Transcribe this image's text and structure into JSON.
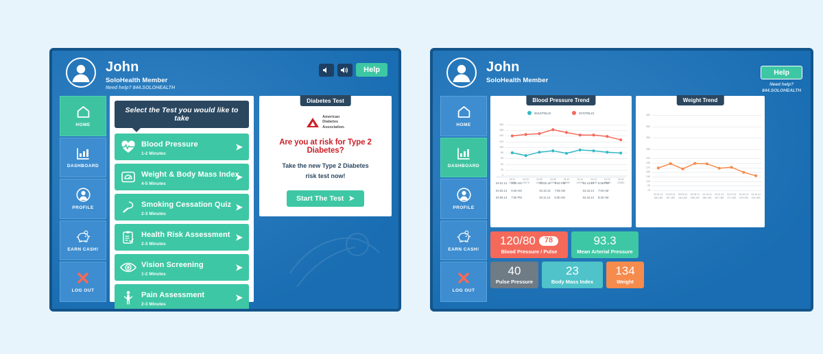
{
  "screen1": {
    "header": {
      "name": "John",
      "member": "SoloHealth Member",
      "help_note": "Need help? 844.SOLOHEALTH",
      "mute_icon": "speaker-mute-icon",
      "volume_icon": "speaker-volume-icon",
      "help_label": "Help"
    },
    "sidebar": {
      "items": [
        {
          "label": "HOME",
          "icon": "home-icon",
          "active": true
        },
        {
          "label": "DASHBOARD",
          "icon": "bar-chart-icon",
          "active": false
        },
        {
          "label": "PROFILE",
          "icon": "user-circle-icon",
          "active": false
        },
        {
          "label": "EARN CASH!",
          "icon": "piggy-bank-icon",
          "active": false
        },
        {
          "label": "LOG OUT",
          "icon": "x-close-icon",
          "active": false
        }
      ]
    },
    "panel": {
      "tooltip": "Select the Test you would like to take",
      "tests": [
        {
          "title": "Blood Pressure",
          "duration": "1-2 Minutes",
          "icon": "heart-pulse-icon"
        },
        {
          "title": "Weight & Body Mass Index",
          "duration": "4-5 Minutes",
          "icon": "scale-icon"
        },
        {
          "title": "Smoking Cessation Quiz",
          "duration": "2-3 Minutes",
          "icon": "cigarette-icon"
        },
        {
          "title": "Health Risk Assessment",
          "duration": "2-3 Minutes",
          "icon": "clipboard-check-icon"
        },
        {
          "title": "Vision Screening",
          "duration": "1-2 Minutes",
          "icon": "eye-icon"
        },
        {
          "title": "Pain Assessment",
          "duration": "2-3 Minutes",
          "icon": "body-icon"
        }
      ]
    },
    "ad": {
      "tab": "Diabetes Test",
      "logo_line1": "American",
      "logo_line2": "Diabetes",
      "logo_line3": "Association.",
      "headline": "Are you at risk for Type 2 Diabetes?",
      "body_line1": "Take the new Type 2 Diabetes",
      "body_line2": "risk test now!",
      "cta": "Start The Test",
      "cta_icon": "chevron-right-icon"
    }
  },
  "screen2": {
    "header": {
      "name": "John",
      "member": "SoloHealth Member",
      "help_label": "Help",
      "help_note_line1": "Need help?",
      "help_note_line2": "844.SOLOHEALTH"
    },
    "sidebar": {
      "items": [
        {
          "label": "HOME",
          "icon": "home-icon",
          "active": false
        },
        {
          "label": "DASHBOARD",
          "icon": "bar-chart-icon",
          "active": true
        },
        {
          "label": "PROFILE",
          "icon": "user-circle-icon",
          "active": false
        },
        {
          "label": "EARN CASH!",
          "icon": "piggy-bank-icon",
          "active": false
        },
        {
          "label": "LOG OUT",
          "icon": "x-close-icon",
          "active": false
        }
      ]
    },
    "bp_panel": {
      "tab": "Blood Pressure Trend"
    },
    "wt_panel": {
      "tab": "Weight Trend"
    },
    "bp_readings": [
      [
        {
          "date": "04.01.14",
          "time": "9:32 AM"
        },
        {
          "date": "04.08.14",
          "time": "9:00 PM"
        },
        {
          "date": "04.13.14",
          "time": "6:58 PM"
        }
      ],
      [
        {
          "date": "04.03.14",
          "time": "6:40 AM"
        },
        {
          "date": "04.10.14",
          "time": "7:56 AM"
        },
        {
          "date": "04.15.14",
          "time": "7:03 AM"
        }
      ],
      [
        {
          "date": "04.05.14",
          "time": "7:00 PM"
        },
        {
          "date": "04.11.14",
          "time": "5:30 AM"
        },
        {
          "date": "04.16.14",
          "time": "8:32 AM"
        }
      ]
    ],
    "tiles": [
      {
        "value": "120/80",
        "pill": "78",
        "label": "Blood Pressure / Pulse",
        "color": "#f4695a"
      },
      {
        "value": "93.3",
        "label": "Mean Arterial Pressure",
        "color": "#3ec7a4"
      },
      {
        "value": "40",
        "label": "Pulse Pressure",
        "color": "#6f7b85"
      },
      {
        "value": "23",
        "label": "Body Mass Index",
        "color": "#4fc3c9"
      },
      {
        "value": "134",
        "label": "Weight",
        "color": "#f58b4c"
      }
    ]
  },
  "chart_data": [
    {
      "type": "line",
      "title": "Blood Pressure Trend",
      "xlabel": "",
      "ylabel": "",
      "ylim": [
        0,
        180
      ],
      "yticks": [
        0,
        20,
        40,
        60,
        80,
        100,
        120,
        140,
        160,
        180
      ],
      "grid": true,
      "legend_position": "top",
      "categories": [
        "04.01\n140/80",
        "04.03\n145/76",
        "04.05\n142/80",
        "04.08\n160/90",
        "04.10\n156/80",
        "04.11\n140/90",
        "04.13\n140/85",
        "04.15\n138/80",
        "04.16\n125/80"
      ],
      "series": [
        {
          "name": "SYSTOLIC",
          "color": "#f4695a",
          "values": [
            140,
            145,
            148,
            162,
            152,
            143,
            143,
            138,
            126
          ]
        },
        {
          "name": "DIASTOLIC",
          "color": "#34b8c4",
          "values": [
            80,
            70,
            82,
            87,
            78,
            90,
            87,
            82,
            79
          ]
        }
      ]
    },
    {
      "type": "line",
      "title": "Weight Trend",
      "xlabel": "",
      "ylabel": "",
      "ylim": [
        70,
        400
      ],
      "yticks": [
        70,
        90,
        110,
        130,
        150,
        170,
        190,
        210,
        250,
        300,
        350,
        400
      ],
      "grid": true,
      "legend_position": "none",
      "categories": [
        "04.01.14\n168 LBS",
        "04.03.14\n187 LBS",
        "04.05.14\n164 LBS",
        "04.08.14\n188 LBS",
        "04.10.14\n186 LBS",
        "04.11.14\n167 LBS",
        "04.13.14\n171 LBS",
        "04.15.14\n149 LBS",
        "04.16.14\n134 LBS"
      ],
      "series": [
        {
          "name": "WEIGHT",
          "color": "#f58b4c",
          "values": [
            168,
            187,
            164,
            188,
            186,
            167,
            171,
            149,
            134
          ]
        }
      ]
    }
  ]
}
